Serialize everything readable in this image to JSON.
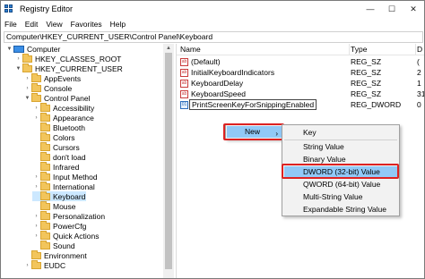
{
  "window": {
    "title": "Registry Editor",
    "minimize": "—",
    "maximize": "☐",
    "close": "✕"
  },
  "menu": [
    "File",
    "Edit",
    "View",
    "Favorites",
    "Help"
  ],
  "address": "Computer\\HKEY_CURRENT_USER\\Control Panel\\Keyboard",
  "tree": {
    "computer": "Computer",
    "hkcr": "HKEY_CLASSES_ROOT",
    "hkcu": "HKEY_CURRENT_USER",
    "appevents": "AppEvents",
    "console": "Console",
    "controlpanel": "Control Panel",
    "children": [
      "Accessibility",
      "Appearance",
      "Bluetooth",
      "Colors",
      "Cursors",
      "don't load",
      "Infrared",
      "Input Method",
      "International",
      "Keyboard",
      "Mouse",
      "Personalization",
      "PowerCfg",
      "Quick Actions",
      "Sound"
    ],
    "environment": "Environment",
    "eudc": "EUDC",
    "selected": "Keyboard"
  },
  "columns": {
    "name": "Name",
    "type": "Type",
    "data": "D"
  },
  "values": [
    {
      "icon": "ab",
      "name": "(Default)",
      "type": "REG_SZ",
      "data": "("
    },
    {
      "icon": "ab",
      "name": "InitialKeyboardIndicators",
      "type": "REG_SZ",
      "data": "2"
    },
    {
      "icon": "ab",
      "name": "KeyboardDelay",
      "type": "REG_SZ",
      "data": "1"
    },
    {
      "icon": "ab",
      "name": "KeyboardSpeed",
      "type": "REG_SZ",
      "data": "31"
    },
    {
      "icon": "dword",
      "name": "PrintScreenKeyForSnippingEnabled",
      "type": "REG_DWORD",
      "data": "0"
    }
  ],
  "context_menu": {
    "new_label": "New",
    "submenu": [
      "Key",
      "String Value",
      "Binary Value",
      "DWORD (32-bit) Value",
      "QWORD (64-bit) Value",
      "Multi-String Value",
      "Expandable String Value"
    ],
    "highlighted": "DWORD (32-bit) Value"
  },
  "colors": {
    "highlight": "#91c9f7",
    "callout": "#dd2222",
    "selection": "#cce8ff"
  }
}
